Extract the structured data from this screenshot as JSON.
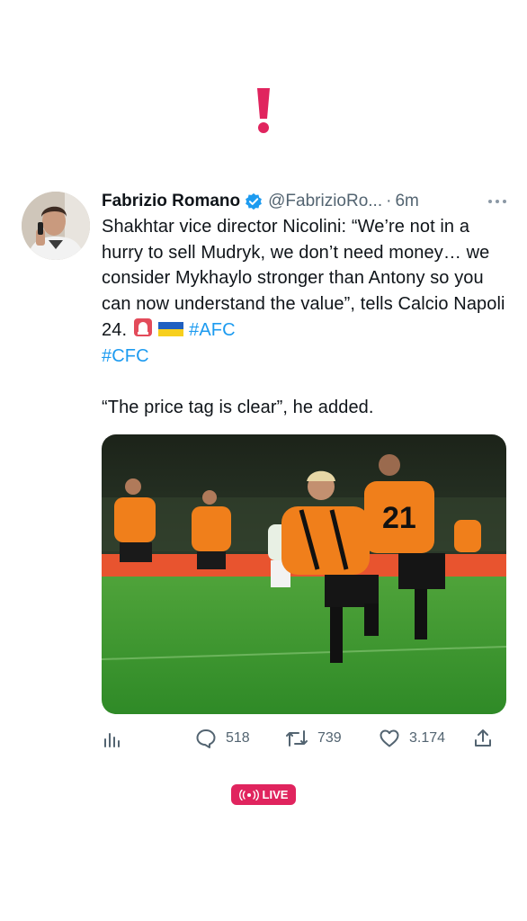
{
  "tweet": {
    "name": "Fabrizio Romano",
    "handle": "@FabrizioRo...",
    "separator": "·",
    "time": "6m",
    "line1": "Shakhtar vice director Nicolini: “We’re not in a hurry to sell Mudryk, we don’t need money… we consider Mykhaylo stronger than Antony so you can now understand the value”, tells Calcio Napoli 24.",
    "hashtag1": "#AFC",
    "hashtag2": "#CFC",
    "line2": "“The price tag is clear”, he added."
  },
  "actions": {
    "replies": "518",
    "retweets": "739",
    "likes": "3.174"
  },
  "live_label": "LIVE",
  "icons": [
    "alert-icon",
    "verified-icon",
    "more-icon",
    "analytics-icon",
    "reply-icon",
    "retweet-icon",
    "like-icon",
    "share-icon",
    "live-icon"
  ],
  "colors": {
    "accent": "#1d9bf0",
    "alert": "#e0245e",
    "verified": "#1d9bf0"
  }
}
